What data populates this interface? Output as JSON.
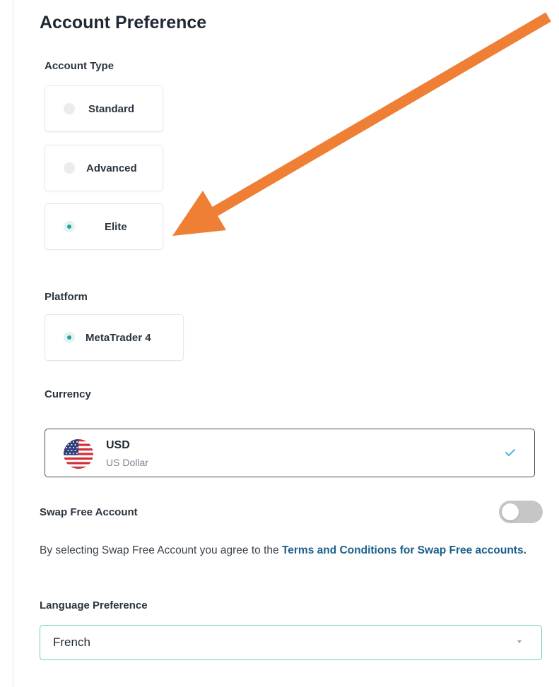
{
  "page": {
    "title": "Account Preference"
  },
  "account_type": {
    "label": "Account Type",
    "options": [
      {
        "label": "Standard",
        "selected": false
      },
      {
        "label": "Advanced",
        "selected": false
      },
      {
        "label": "Elite",
        "selected": true
      }
    ]
  },
  "platform": {
    "label": "Platform",
    "options": [
      {
        "label": "MetaTrader 4",
        "selected": true
      }
    ]
  },
  "currency": {
    "label": "Currency",
    "selected_code": "USD",
    "selected_name": "US Dollar",
    "flag_icon": "us-flag-icon",
    "check_icon": "check-icon"
  },
  "swap_free": {
    "label": "Swap Free Account",
    "enabled": false,
    "disclaimer_text": "By selecting Swap Free Account you agree to the ",
    "terms_link": "Terms and Conditions for Swap Free accounts."
  },
  "language": {
    "label": "Language Preference",
    "selected": "French",
    "caret_icon": "chevron-down-icon"
  },
  "annotation": {
    "icon": "arrow-icon",
    "color": "#f07f36"
  },
  "colors": {
    "accent": "#1aa59d",
    "link": "#1a5f8a",
    "focus_border": "#6ccfc1"
  }
}
